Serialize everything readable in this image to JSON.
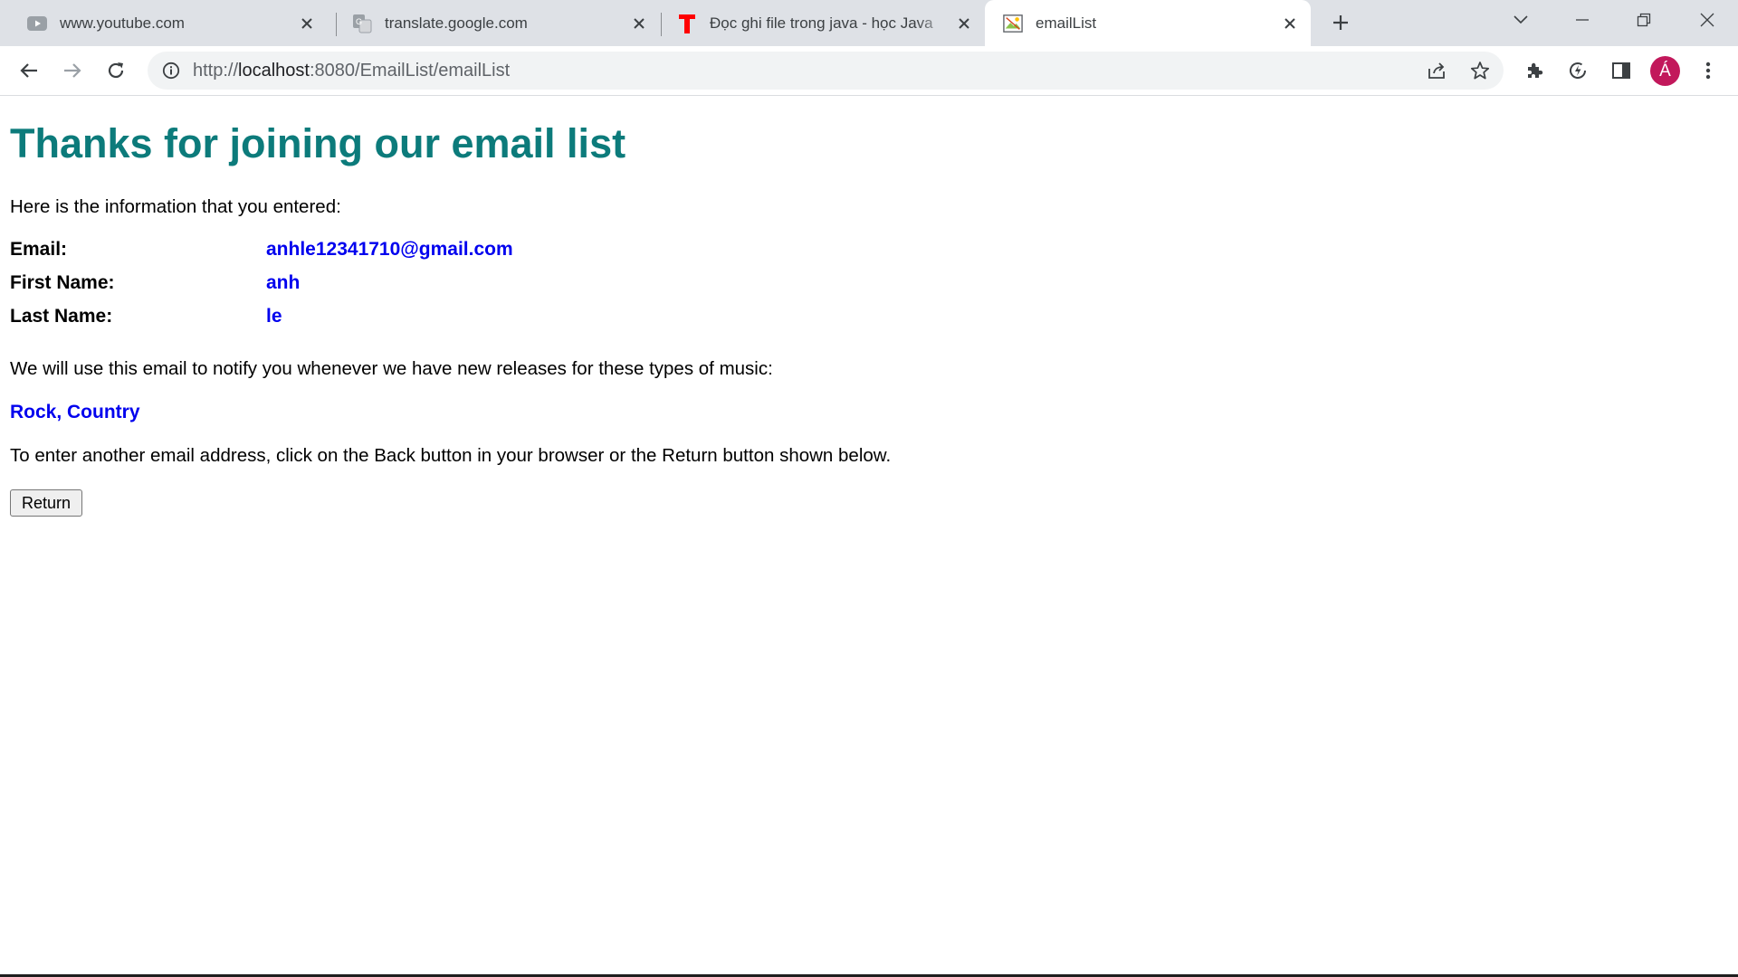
{
  "browser": {
    "tabs": [
      {
        "title": "www.youtube.com",
        "icon": "youtube-icon",
        "active": false
      },
      {
        "title": "translate.google.com",
        "icon": "translate-icon",
        "active": false
      },
      {
        "title": "Đọc ghi file trong java - học Java",
        "icon": "t-logo-icon",
        "active": false
      },
      {
        "title": "emailList",
        "icon": "broken-image-icon",
        "active": true
      }
    ],
    "address": {
      "scheme": "http://",
      "host": "localhost",
      "rest": ":8080/EmailList/emailList"
    },
    "profile_initial": "Á",
    "colors": {
      "tabstrip": "#dee1e6",
      "omnibox": "#f1f3f4",
      "avatar": "#c2185b",
      "youtube_red": "#ff0000"
    }
  },
  "page": {
    "heading": "Thanks for joining our email list",
    "intro": "Here is the information that you entered:",
    "fields": [
      {
        "label": "Email:",
        "value": "anhle12341710@gmail.com"
      },
      {
        "label": "First Name:",
        "value": "anh"
      },
      {
        "label": "Last Name:",
        "value": "le"
      }
    ],
    "notify_text": "We will use this email to notify you whenever we have new releases for these types of music:",
    "music_types": "Rock, Country",
    "another_text": "To enter another email address, click on the Back button in your browser or the Return button shown below.",
    "return_label": "Return",
    "colors": {
      "heading": "#0c7b7b",
      "value": "#0000ee"
    }
  }
}
